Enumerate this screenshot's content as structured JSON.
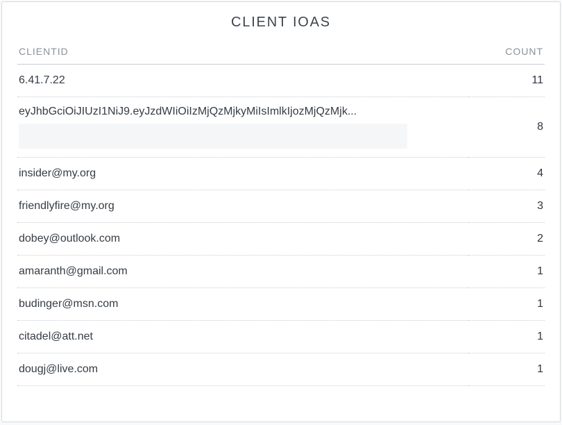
{
  "panel": {
    "title": "CLIENT IOAS"
  },
  "columns": {
    "clientid": "CLIENTID",
    "count": "COUNT"
  },
  "rows": [
    {
      "clientid": "6.41.7.22",
      "count": 11,
      "token": false
    },
    {
      "clientid": "eyJhbGciOiJIUzI1NiJ9.eyJzdWIiOiIzMjQzMjkyMiIsImlkIjozMjQzMjk...",
      "count": 8,
      "token": true
    },
    {
      "clientid": "insider@my.org",
      "count": 4,
      "token": false
    },
    {
      "clientid": "friendlyfire@my.org",
      "count": 3,
      "token": false
    },
    {
      "clientid": "dobey@outlook.com",
      "count": 2,
      "token": false
    },
    {
      "clientid": "amaranth@gmail.com",
      "count": 1,
      "token": false
    },
    {
      "clientid": "budinger@msn.com",
      "count": 1,
      "token": false
    },
    {
      "clientid": "citadel@att.net",
      "count": 1,
      "token": false
    },
    {
      "clientid": "dougj@live.com",
      "count": 1,
      "token": false
    }
  ]
}
